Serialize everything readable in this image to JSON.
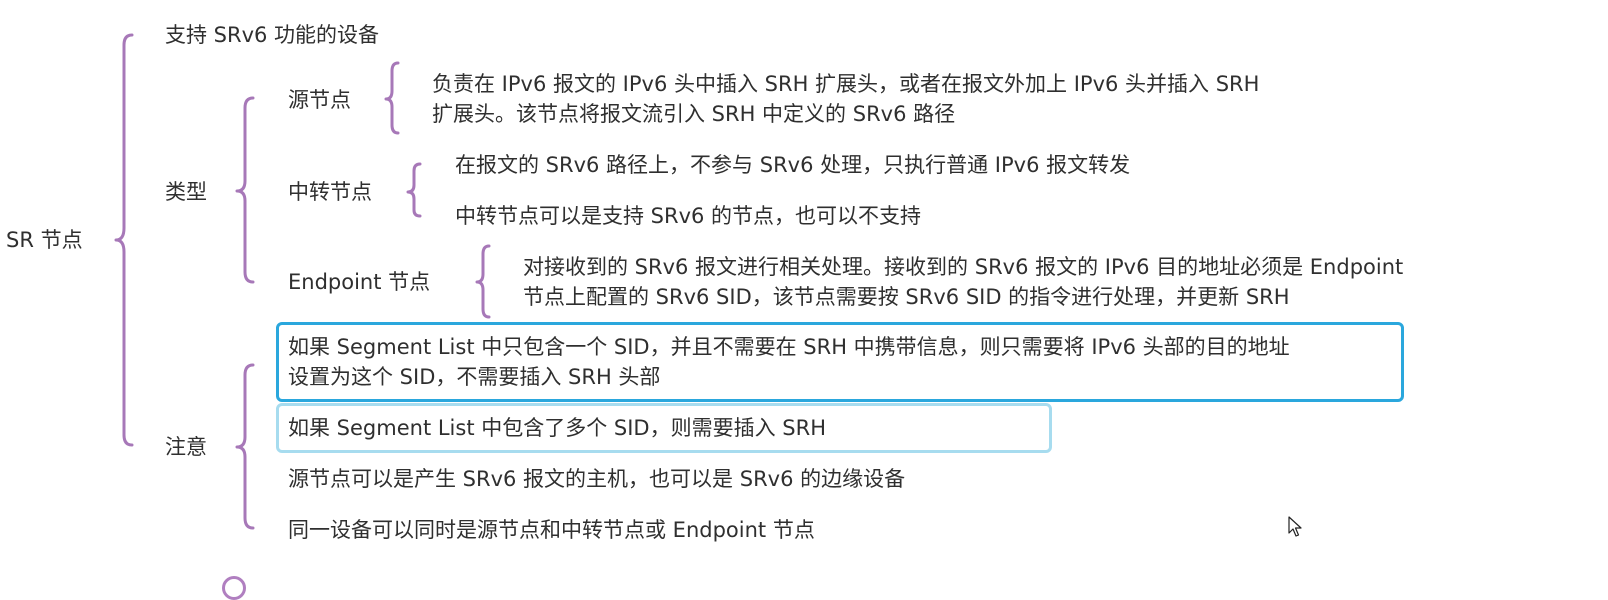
{
  "root": {
    "label": "SR 节点"
  },
  "support": {
    "label": "支持 SRv6 功能的设备"
  },
  "types": {
    "label": "类型",
    "source": {
      "label": "源节点",
      "lines": [
        "负责在 IPv6 报文的 IPv6 头中插入 SRH 扩展头，或者在报文外加上 IPv6 头并插入 SRH",
        "扩展头。该节点将报文流引入 SRH 中定义的 SRv6 路径"
      ]
    },
    "transit": {
      "label": "中转节点",
      "items": [
        "在报文的 SRv6 路径上，不参与 SRv6 处理，只执行普通 IPv6 报文转发",
        "中转节点可以是支持 SRv6 的节点，也可以不支持"
      ]
    },
    "endpoint": {
      "label": "Endpoint 节点",
      "lines": [
        "对接收到的 SRv6 报文进行相关处理。接收到的 SRv6 报文的 IPv6 目的地址必须是 Endpoint",
        "节点上配置的 SRv6 SID，该节点需要按 SRv6 SID 的指令进行处理，并更新 SRH"
      ]
    }
  },
  "notes": {
    "label": "注意",
    "note1_lines": [
      "如果 Segment List 中只包含一个 SID，并且不需要在 SRH 中携带信息，则只需要将 IPv6 头部的目的地址",
      "设置为这个 SID，不需要插入 SRH 头部"
    ],
    "note2": "如果 Segment List 中包含了多个 SID，则需要插入 SRH",
    "note3": "源节点可以是产生 SRv6 报文的主机，也可以是 SRv6 的边缘设备",
    "note4": "同一设备可以同时是源节点和中转节点或 Endpoint 节点"
  },
  "colors": {
    "bracket": "#a778b8",
    "highlight_strong": "#2aa7dd",
    "highlight_light": "#a7dcef",
    "text": "#2f2f2f"
  }
}
